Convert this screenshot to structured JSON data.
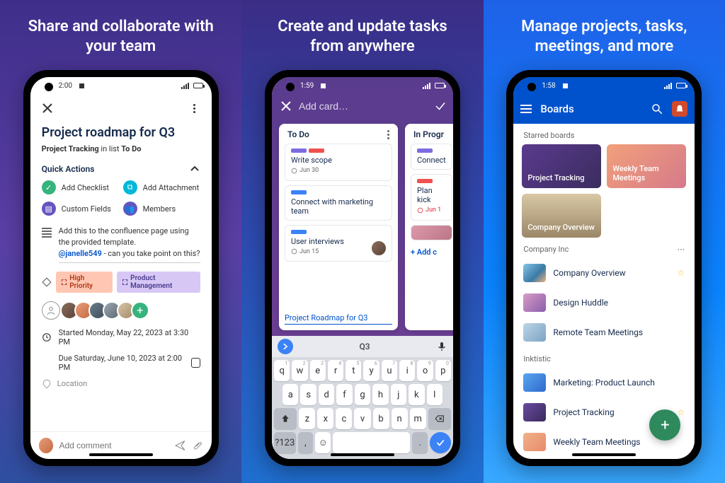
{
  "panels": [
    {
      "headline": "Share and collaborate with\nyour team"
    },
    {
      "headline": "Create and update tasks\nfrom anywhere"
    },
    {
      "headline": "Manage projects, tasks,\nmeetings, and more"
    }
  ],
  "screen1": {
    "status_time": "2:00",
    "title": "Project roadmap for Q3",
    "subtitle_prefix": "Project Tracking",
    "subtitle_mid": " in list ",
    "subtitle_list": "To Do",
    "quick_actions_label": "Quick Actions",
    "actions": {
      "checklist": "Add Checklist",
      "attachment": "Add Attachment",
      "custom_fields": "Custom Fields",
      "members": "Members"
    },
    "description": {
      "line1": "Add this to the confluence page using the provided template.",
      "mention": "@janelle549",
      "line2": " - can you take point on this?"
    },
    "tags": {
      "high": "High Priority",
      "pm": "Product Management"
    },
    "dates": {
      "started": "Started Monday, May 22, 2023 at 3:30 PM",
      "due": "Due Saturday, June 10, 2023 at 2:00 PM"
    },
    "location_label": "Location",
    "comment_placeholder": "Add comment"
  },
  "screen2": {
    "status_time": "1:59",
    "add_card_placeholder": "Add card…",
    "lists": {
      "todo": {
        "title": "To Do",
        "cards": [
          {
            "title": "Write scope",
            "due": "Jun 30"
          },
          {
            "title": "Connect with marketing team"
          },
          {
            "title": "User interviews",
            "due": "Jun 15"
          }
        ],
        "new_card_text": "Project Roadmap for Q3"
      },
      "in_progress": {
        "title": "In Progr",
        "cards": [
          {
            "title": "Connect"
          },
          {
            "title": "Plan kick",
            "due": "Jun 1"
          }
        ],
        "add_link": "+ Add c"
      }
    },
    "keyboard": {
      "suggestion": "Q3",
      "row1": [
        "q",
        "w",
        "e",
        "r",
        "t",
        "y",
        "u",
        "i",
        "o",
        "p"
      ],
      "row1_nums": [
        "1",
        "2",
        "3",
        "4",
        "5",
        "6",
        "7",
        "8",
        "9",
        "0"
      ],
      "row2": [
        "a",
        "s",
        "d",
        "f",
        "g",
        "h",
        "j",
        "k",
        "l"
      ],
      "row3": [
        "z",
        "x",
        "c",
        "v",
        "b",
        "n",
        "m"
      ],
      "mode_key": "?123"
    }
  },
  "screen3": {
    "status_time": "1:58",
    "topbar_title": "Boards",
    "sections": {
      "starred_label": "Starred boards",
      "starred": [
        {
          "name": "Project Tracking"
        },
        {
          "name": "Weekly Team Meetings"
        },
        {
          "name": "Company Overview"
        }
      ],
      "company_label": "Company Inc",
      "company_boards": [
        {
          "name": "Company Overview",
          "starred": true
        },
        {
          "name": "Design Huddle"
        },
        {
          "name": "Remote Team Meetings"
        }
      ],
      "inktistic_label": "Inktistic",
      "inktistic_boards": [
        {
          "name": "Marketing: Product Launch"
        },
        {
          "name": "Project Tracking",
          "starred": true
        },
        {
          "name": "Weekly Team Meetings"
        }
      ]
    }
  }
}
